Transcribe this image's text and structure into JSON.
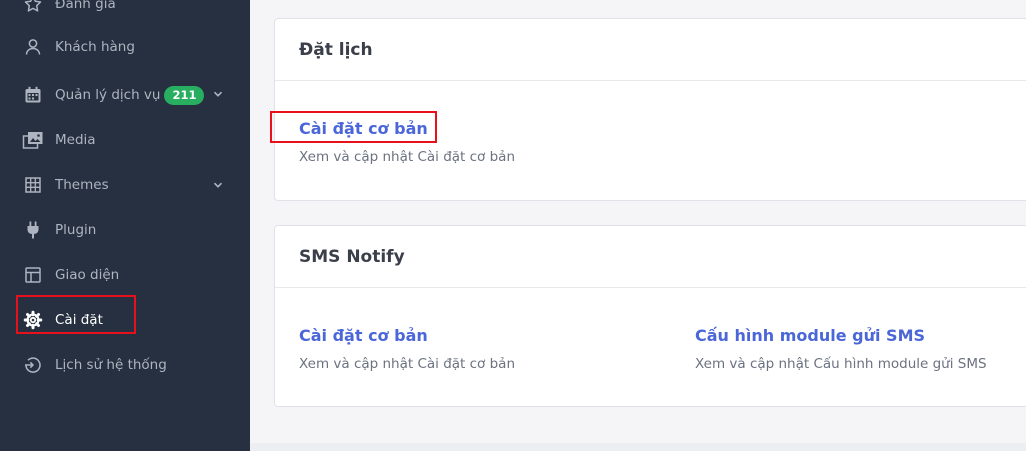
{
  "sidebar": {
    "items": [
      {
        "label": "Đánh giá",
        "icon": "star-icon"
      },
      {
        "label": "Khách hàng",
        "icon": "user-icon"
      },
      {
        "label": "Quản lý dịch vụ",
        "icon": "calendar-icon",
        "badge": "211",
        "chevron": true
      },
      {
        "label": "Media",
        "icon": "media-icon"
      },
      {
        "label": "Themes",
        "icon": "grid-icon",
        "chevron": true
      },
      {
        "label": "Plugin",
        "icon": "plug-icon"
      },
      {
        "label": "Giao diện",
        "icon": "layout-icon"
      },
      {
        "label": "Cài đặt",
        "icon": "gear-icon",
        "active": true
      },
      {
        "label": "Lịch sử hệ thống",
        "icon": "history-icon"
      }
    ]
  },
  "sections": [
    {
      "title": "Đặt lịch",
      "settings": [
        {
          "title": "Cài đặt cơ bản",
          "description": "Xem và cập nhật Cài đặt cơ bản"
        }
      ]
    },
    {
      "title": "SMS Notify",
      "settings": [
        {
          "title": "Cài đặt cơ bản",
          "description": "Xem và cập nhật Cài đặt cơ bản"
        },
        {
          "title": "Cấu hình module gửi SMS",
          "description": "Xem và cập nhật Cấu hình module gửi SMS"
        }
      ]
    }
  ],
  "colors": {
    "sidebar_bg": "#263040",
    "link": "#4a66d8",
    "badge": "#27ae60",
    "highlight": "#e8101a"
  }
}
